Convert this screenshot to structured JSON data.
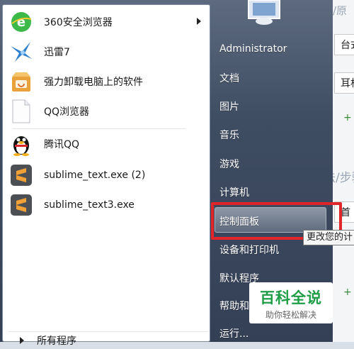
{
  "background": {
    "header_text": "工具/原",
    "field1": "台式",
    "field2": "耳机",
    "plus1": "+",
    "section_title": "方法/步骤",
    "field3": "首",
    "plus2": "+"
  },
  "left_pane": {
    "items": [
      {
        "label": "360安全浏览器",
        "icon": "360-browser-icon",
        "has_submenu": true
      },
      {
        "label": "迅雷7",
        "icon": "xunlei-bird-icon"
      },
      {
        "label": "强力卸载电脑上的软件",
        "icon": "uninstall-box-icon"
      },
      {
        "label": "QQ浏览器",
        "icon": "blank-document-icon"
      },
      {
        "label": "腾讯QQ",
        "icon": "qq-penguin-icon"
      },
      {
        "label": "sublime_text.exe (2)",
        "icon": "sublime-text-icon"
      },
      {
        "label": "sublime_text3.exe",
        "icon": "sublime-text-icon"
      }
    ],
    "all_programs": "所有程序"
  },
  "right_pane": {
    "user": "Administrator",
    "items": [
      "文档",
      "图片",
      "音乐",
      "游戏",
      "计算机",
      "控制面板",
      "设备和打印机",
      "默认程序",
      "帮助和",
      "运行..."
    ],
    "highlighted": "控制面板"
  },
  "tooltip": "更改您的计",
  "watermark": {
    "title": "百科全说",
    "subtitle": "助你轻松解决"
  },
  "colors": {
    "highlight_box": "#e0262b",
    "watermark_green": "#1e9d46",
    "menu_dark": "#3f4d63"
  }
}
